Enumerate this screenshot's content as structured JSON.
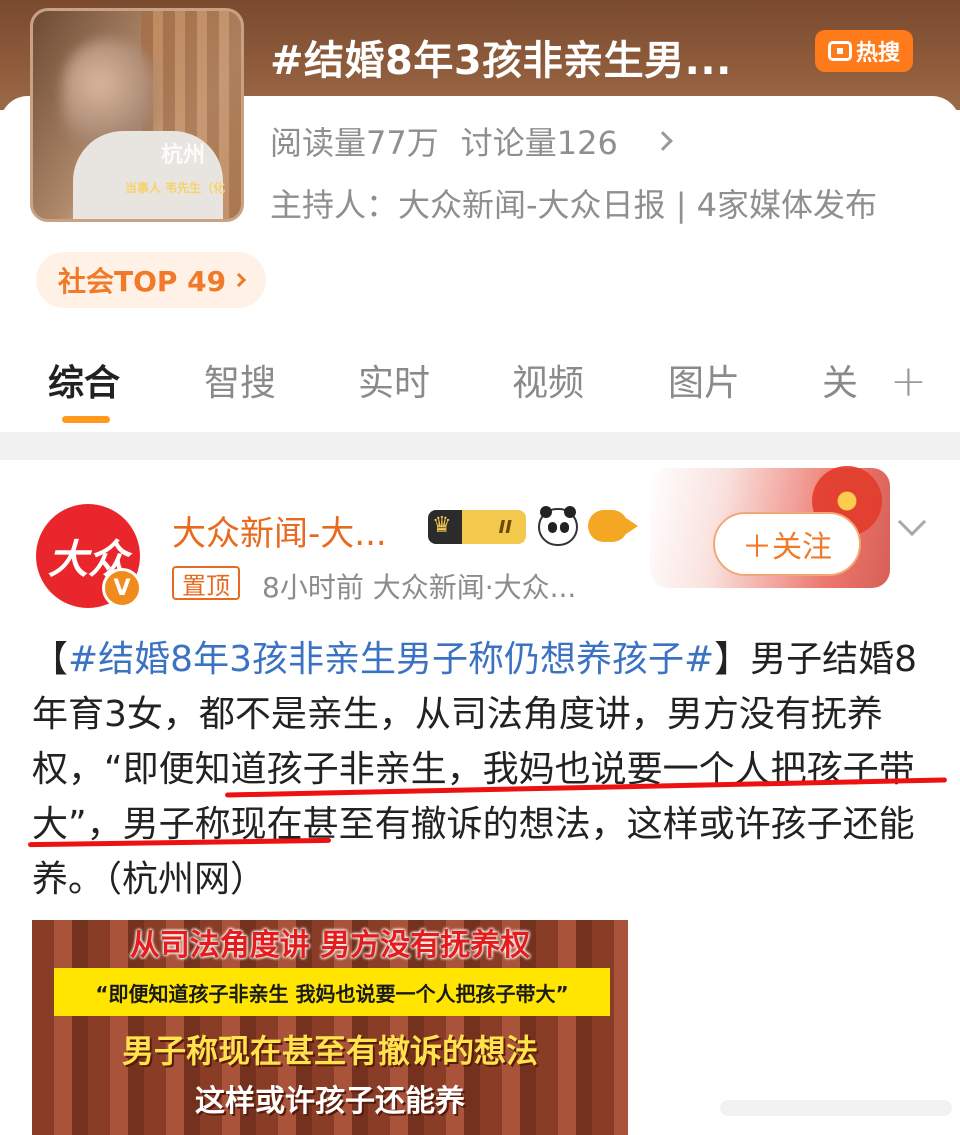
{
  "topic": {
    "title": "#结婚8年3孩非亲生男...",
    "hot_badge": "热搜",
    "reads": "阅读量77万",
    "discussions": "讨论量126",
    "host": "主持人：大众新闻-大众日报 | 4家媒体发布",
    "rank": "社会TOP 49",
    "thumb_watermark": "杭州",
    "thumb_caption": "当事人 韦先生（化"
  },
  "tabs": [
    "综合",
    "智搜",
    "实时",
    "视频",
    "图片",
    "关"
  ],
  "active_tab": "综合",
  "post": {
    "avatar_text": "大众",
    "author": "大众新闻-大...",
    "level": "II",
    "pin": "置顶",
    "meta": "8小时前  大众新闻·大众...",
    "follow": "＋关注",
    "text_open": "【",
    "hashtag": "#结婚8年3孩非亲生男子称仍想养孩子#",
    "text_body": "】男子结婚8年育3女，都不是亲生，从司法角度讲，男方没有抚养权，“即便知道孩子非亲生，我妈也说要一个人把孩子带大”，男子称现在甚至有撤诉的想法，这样或许孩子还能养。（杭州网）"
  },
  "image_text": {
    "line1": "从司法角度讲 男方没有抚养权",
    "line2": "“即便知道孩子非亲生 我妈也说要一个人把孩子带大”",
    "line3": "男子称现在甚至有撤诉的想法",
    "line4": "这样或许孩子还能养"
  },
  "colors": {
    "accent_orange": "#f07a2a",
    "hashtag_blue": "#3b73c2",
    "underline_red": "#ee1111"
  }
}
